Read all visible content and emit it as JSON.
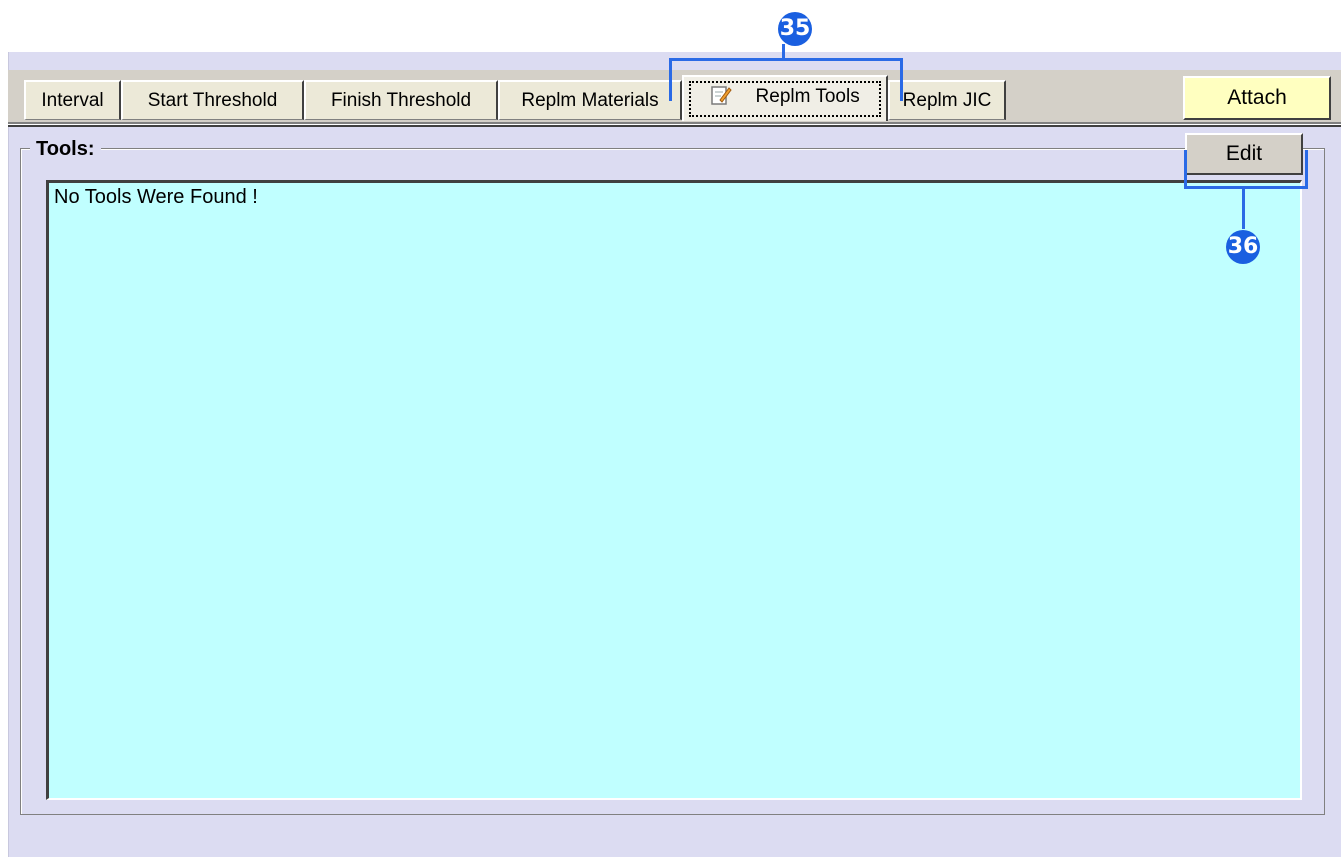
{
  "tabs": [
    {
      "label": "Interval",
      "active": false
    },
    {
      "label": "Start Threshold",
      "active": false
    },
    {
      "label": "Finish Threshold",
      "active": false
    },
    {
      "label": "Replm Materials",
      "active": false
    },
    {
      "label": "Replm Tools",
      "active": true,
      "icon": "edit-note-icon"
    },
    {
      "label": "Replm JIC",
      "active": false
    }
  ],
  "attach_button": "Attach",
  "tools_group": {
    "label": "Tools:",
    "edit_button": "Edit",
    "empty_message": "No Tools Were Found !"
  },
  "callouts": {
    "tabs": "35",
    "edit": "36"
  },
  "colors": {
    "panel_bg": "#dcdcf2",
    "list_bg": "#c0ffff",
    "attach_bg": "#ffffc0",
    "callout": "#1a5fe0"
  }
}
